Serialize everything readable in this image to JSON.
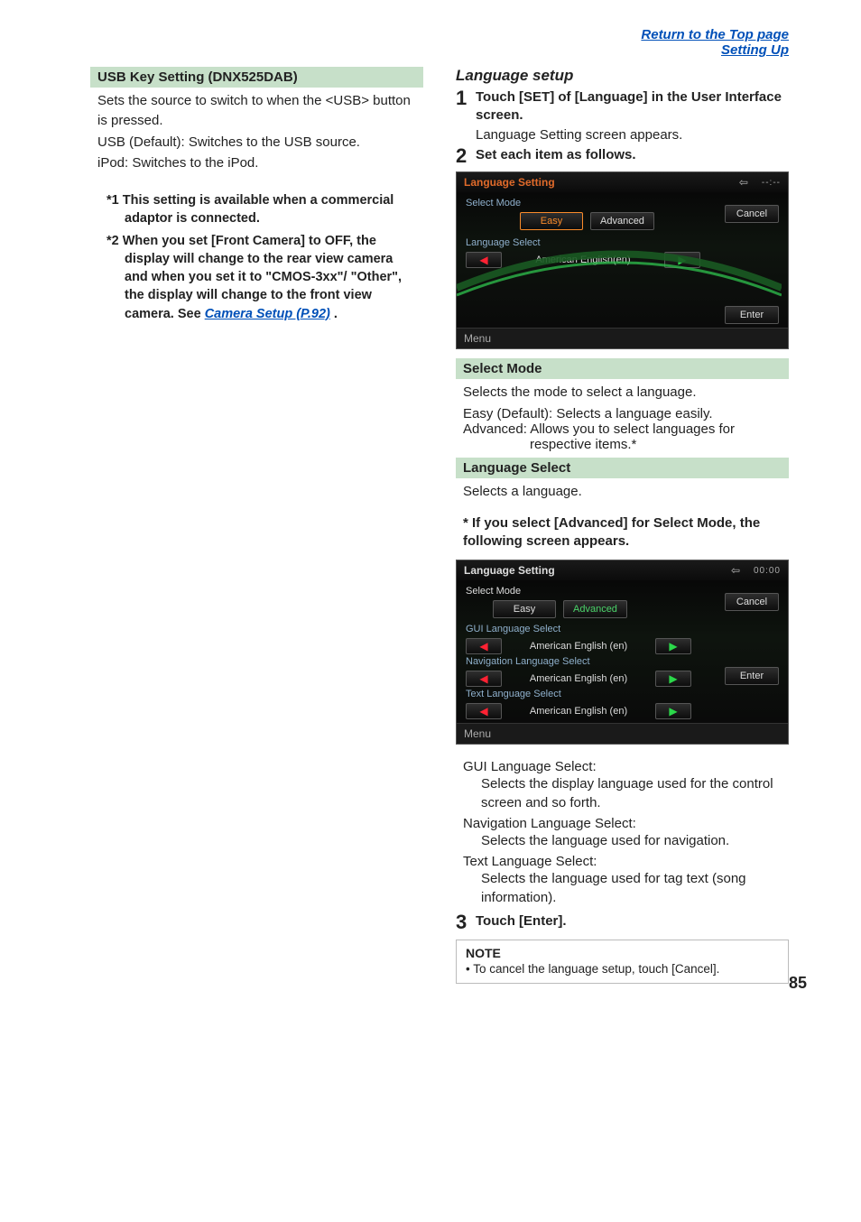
{
  "top_links": {
    "top": "Return to the Top page",
    "section": "Setting Up"
  },
  "left": {
    "usb_heading": "USB Key Setting",
    "usb_heading_sub": "(DNX525DAB)",
    "usb_desc_1": "Sets the source to switch to when the <USB> button is pressed.",
    "usb_desc_2": "USB (Default): Switches to the USB source.",
    "usb_desc_3": "iPod: Switches to the iPod.",
    "fn1_tag": "*1",
    "fn1": "This setting is available when a commercial adaptor is connected.",
    "fn2_tag": "*2",
    "fn2_a": "When you set [Front Camera] to OFF, the display will change to the rear view camera and when you set it to \"CMOS-3xx\"/ \"Other\", the display will change to the front view camera. See ",
    "fn2_link": "Camera Setup (P.92)",
    "fn2_b": "."
  },
  "right": {
    "subhead": "Language setup",
    "step1_title": "Touch [SET] of [Language] in the User Interface screen.",
    "step1_desc": "Language Setting screen appears.",
    "step2_title": "Set each item as follows.",
    "shot1": {
      "title": "Language Setting",
      "time": "--:--",
      "row1_label": "Select Mode",
      "easy": "Easy",
      "advanced": "Advanced",
      "row2_label": "Language Select",
      "lang": "American English(en)",
      "cancel": "Cancel",
      "enter": "Enter",
      "menu": "Menu"
    },
    "sel_mode_h": "Select Mode",
    "sel_mode_desc": "Selects the mode to select a language.",
    "easy_k": "Easy (Default)",
    "easy_v": ": Selects a language easily.",
    "adv_k": "Advanced",
    "adv_v": ": Allows you to select languages for respective items.*",
    "lang_sel_h": "Language Select",
    "lang_sel_desc": "Selects a language.",
    "star_note": "* If you select [Advanced] for Select Mode, the following screen appears.",
    "shot2": {
      "title": "Language Setting",
      "time": "00:00",
      "row1_label": "Select Mode",
      "easy": "Easy",
      "advanced": "Advanced",
      "gui_label": "GUI Language Select",
      "gui_val": "American English (en)",
      "nav_label": "Navigation Language Select",
      "nav_val": "American English (en)",
      "txt_label": "Text Language Select",
      "txt_val": "American English (en)",
      "cancel": "Cancel",
      "enter": "Enter",
      "menu": "Menu"
    },
    "g_gui_t": "GUI Language Select",
    "g_gui_d": "Selects the display language used for the control screen and so forth.",
    "g_nav_t": "Navigation Language Select",
    "g_nav_d": "Selects the language used for navigation.",
    "g_txt_t": "Text Language Select",
    "g_txt_d": "Selects the language used for tag text (song information).",
    "step3_title": "Touch [Enter].",
    "note_h": "NOTE",
    "note_line": "• To cancel the language setup, touch [Cancel]."
  },
  "page_num": "85"
}
